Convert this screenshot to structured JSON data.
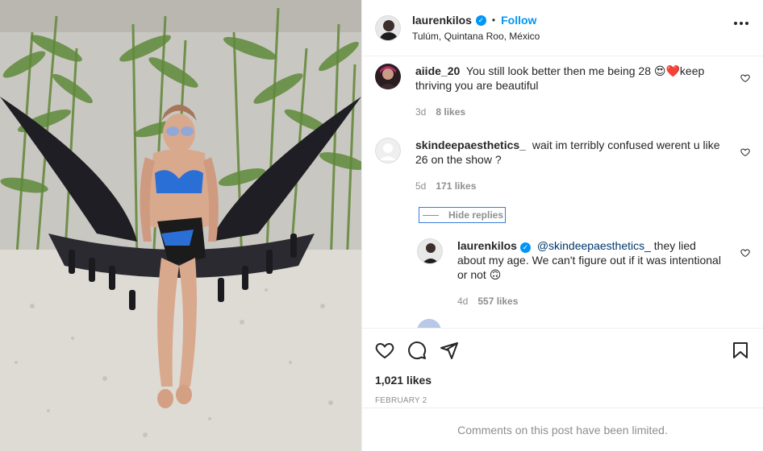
{
  "post": {
    "photo_alt": "",
    "author": {
      "username": "laurenkilos",
      "verified": true,
      "follow_label": "Follow",
      "location": "Tulúm, Quintana Roo, México",
      "separator": "•"
    },
    "comments": [
      {
        "username": "aiide_20",
        "text": "You still look better then me being 28 😍❤️keep thriving you are beautiful",
        "age": "3d",
        "likes": "8 likes"
      },
      {
        "username": "skindeepaesthetics_",
        "text": "wait im terribly confused werent u like 26 on the show ?",
        "age": "5d",
        "likes": "171 likes",
        "hide_replies_label": "Hide replies"
      }
    ],
    "reply": {
      "username": "laurenkilos",
      "mention": "@skindeepaesthetics_",
      "text": "they lied about my age. We can't figure out if it was intentional or not 🙃",
      "age": "4d",
      "likes": "557 likes"
    },
    "likes_count": "1,021 likes",
    "date": "FEBRUARY 2",
    "limited_notice": "Comments on this post have been limited."
  }
}
